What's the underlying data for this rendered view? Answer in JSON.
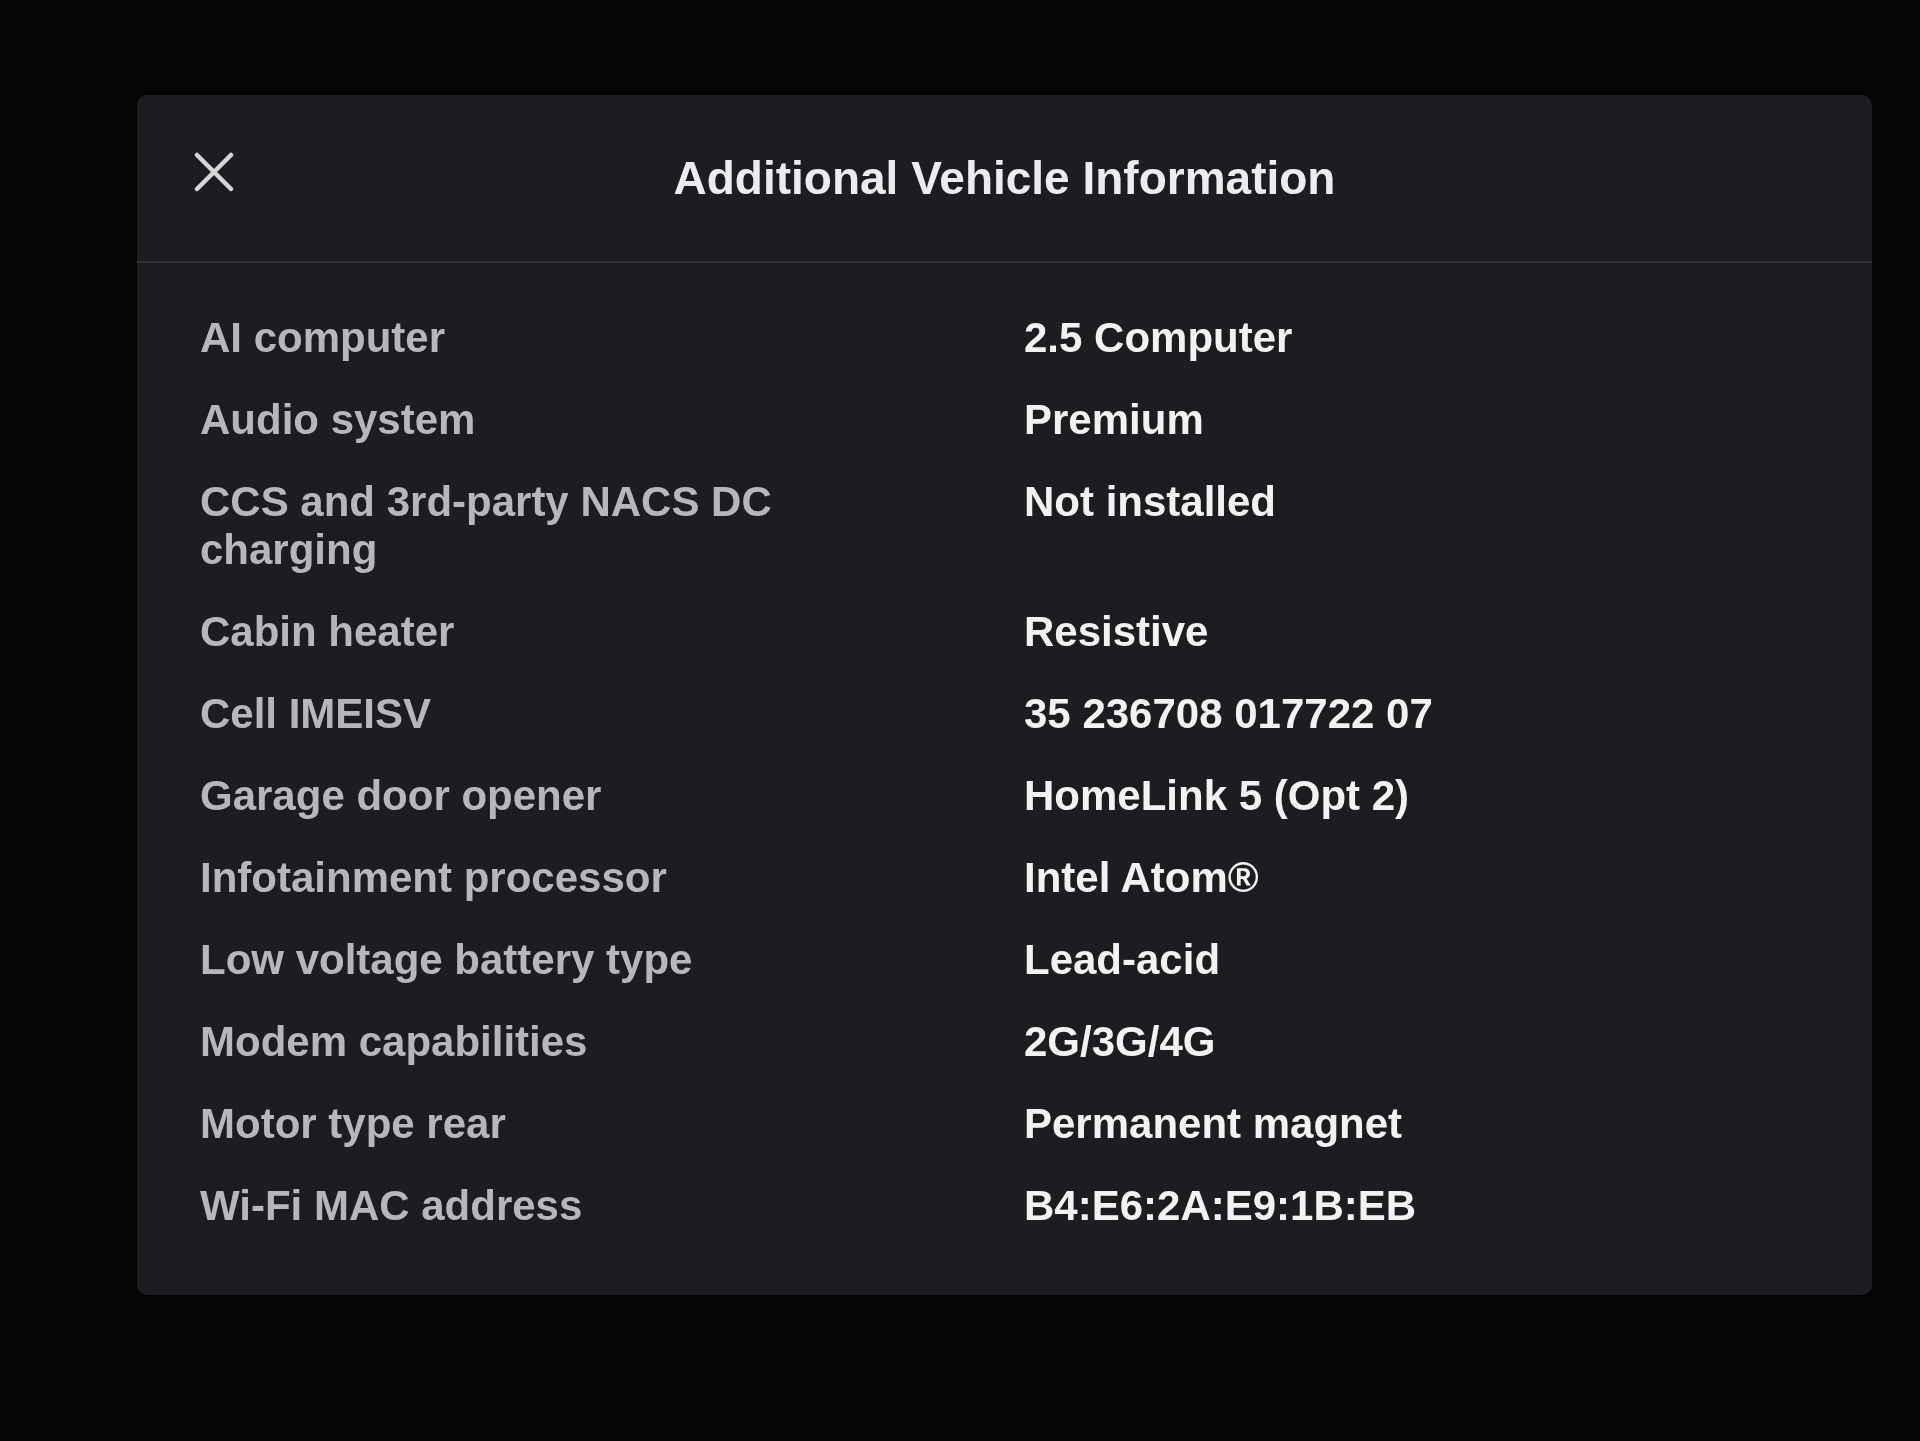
{
  "dialog": {
    "title": "Additional Vehicle Information",
    "rows": [
      {
        "label": "AI computer",
        "value": "2.5 Computer"
      },
      {
        "label": "Audio system",
        "value": "Premium"
      },
      {
        "label": "CCS and 3rd-party NACS DC charging",
        "value": "Not installed"
      },
      {
        "label": "Cabin heater",
        "value": "Resistive"
      },
      {
        "label": "Cell IMEISV",
        "value": "35 236708 017722 07"
      },
      {
        "label": "Garage door opener",
        "value": "HomeLink 5 (Opt 2)"
      },
      {
        "label": "Infotainment processor",
        "value": "Intel Atom®"
      },
      {
        "label": "Low voltage battery type",
        "value": "Lead-acid"
      },
      {
        "label": "Modem capabilities",
        "value": "2G/3G/4G"
      },
      {
        "label": "Motor type rear",
        "value": "Permanent magnet"
      },
      {
        "label": "Wi-Fi MAC address",
        "value": "B4:E6:2A:E9:1B:EB"
      }
    ]
  }
}
